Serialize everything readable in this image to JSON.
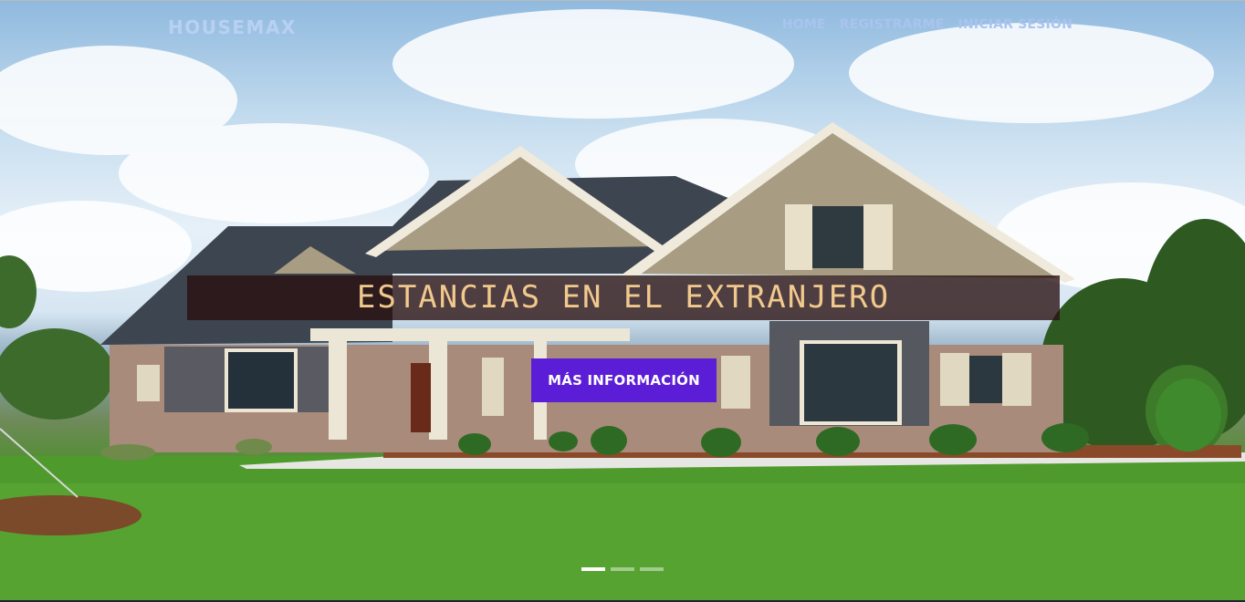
{
  "brand": "HOUSEMAX",
  "nav": [
    {
      "label": "HOME"
    },
    {
      "label": "REGISTRARME"
    },
    {
      "label": "INICIAR SESIÓN"
    }
  ],
  "hero": {
    "headline": "ESTANCIAS EN EL EXTRANJERO",
    "cta_label": "MÁS INFORMACIÓN",
    "slide_count": 3,
    "active_slide": 1
  },
  "colors": {
    "cta": "#5b1ed6",
    "headline_text": "#f2c98d",
    "nav_text": "#a9c4ee"
  }
}
